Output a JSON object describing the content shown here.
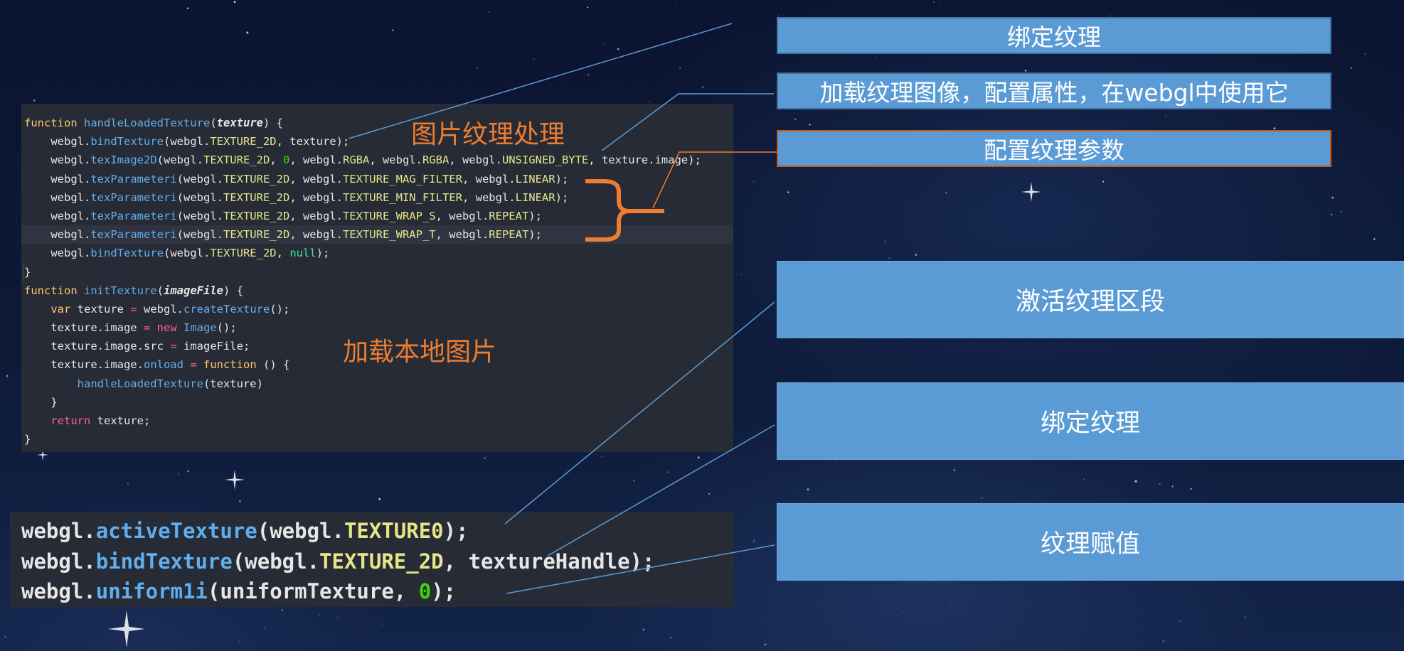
{
  "annotations": {
    "texture_processing": "图片纹理处理",
    "load_local_image": "加载本地图片"
  },
  "labels": {
    "bind_texture_top": "绑定纹理",
    "load_image": "加载纹理图像，配置属性，在webgl中使用它",
    "configure_params": "配置纹理参数",
    "activate_unit": "激活纹理区段",
    "bind_texture": "绑定纹理",
    "assign_texture": "纹理赋值"
  },
  "colors": {
    "label_bg": "#5b9bd5",
    "annotation": "#ed7d31",
    "connector": "#5b9bd5",
    "code_bg": "#272b35"
  },
  "code_main": [
    [
      [
        "kw",
        "function"
      ],
      [
        "plain",
        " "
      ],
      [
        "fn",
        "handleLoadedTexture"
      ],
      [
        "plain",
        "("
      ],
      [
        "param",
        "texture"
      ],
      [
        "plain",
        ") {"
      ]
    ],
    [
      [
        "plain",
        "    webgl."
      ],
      [
        "fn",
        "bindTexture"
      ],
      [
        "plain",
        "(webgl."
      ],
      [
        "const",
        "TEXTURE_2D"
      ],
      [
        "plain",
        ", texture);"
      ]
    ],
    [
      [
        "plain",
        "    webgl."
      ],
      [
        "fn",
        "texImage2D"
      ],
      [
        "plain",
        "(webgl."
      ],
      [
        "const",
        "TEXTURE_2D"
      ],
      [
        "plain",
        ", "
      ],
      [
        "num",
        "0"
      ],
      [
        "plain",
        ", webgl."
      ],
      [
        "const",
        "RGBA"
      ],
      [
        "plain",
        ", webgl."
      ],
      [
        "const",
        "RGBA"
      ],
      [
        "plain",
        ", webgl."
      ],
      [
        "const",
        "UNSIGNED_BYTE"
      ],
      [
        "plain",
        ", texture.image);"
      ]
    ],
    [
      [
        "plain",
        "    webgl."
      ],
      [
        "fn",
        "texParameteri"
      ],
      [
        "plain",
        "(webgl."
      ],
      [
        "const",
        "TEXTURE_2D"
      ],
      [
        "plain",
        ", webgl."
      ],
      [
        "const",
        "TEXTURE_MAG_FILTER"
      ],
      [
        "plain",
        ", webgl."
      ],
      [
        "const",
        "LINEAR"
      ],
      [
        "plain",
        ");"
      ]
    ],
    [
      [
        "plain",
        "    webgl."
      ],
      [
        "fn",
        "texParameteri"
      ],
      [
        "plain",
        "(webgl."
      ],
      [
        "const",
        "TEXTURE_2D"
      ],
      [
        "plain",
        ", webgl."
      ],
      [
        "const",
        "TEXTURE_MIN_FILTER"
      ],
      [
        "plain",
        ", webgl."
      ],
      [
        "const",
        "LINEAR"
      ],
      [
        "plain",
        ");"
      ]
    ],
    [
      [
        "plain",
        "    webgl."
      ],
      [
        "fn",
        "texParameteri"
      ],
      [
        "plain",
        "(webgl."
      ],
      [
        "const",
        "TEXTURE_2D"
      ],
      [
        "plain",
        ", webgl."
      ],
      [
        "const",
        "TEXTURE_WRAP_S"
      ],
      [
        "plain",
        ", webgl."
      ],
      [
        "const",
        "REPEAT"
      ],
      [
        "plain",
        ");"
      ]
    ],
    [
      [
        "plain",
        "    webgl."
      ],
      [
        "fn",
        "texParameteri"
      ],
      [
        "plain",
        "(webgl."
      ],
      [
        "const",
        "TEXTURE_2D"
      ],
      [
        "plain",
        ", webgl."
      ],
      [
        "const",
        "TEXTURE_WRAP_T"
      ],
      [
        "plain",
        ", webgl."
      ],
      [
        "const",
        "REPEAT"
      ],
      [
        "plain",
        ");"
      ]
    ],
    [
      [
        "plain",
        "    webgl."
      ],
      [
        "fn",
        "bindTexture"
      ],
      [
        "plain",
        "(webgl."
      ],
      [
        "const",
        "TEXTURE_2D"
      ],
      [
        "plain",
        ", "
      ],
      [
        "null",
        "null"
      ],
      [
        "plain",
        ");"
      ]
    ],
    [
      [
        "plain",
        "}"
      ]
    ],
    [
      [
        "kw",
        "function"
      ],
      [
        "plain",
        " "
      ],
      [
        "fn",
        "initTexture"
      ],
      [
        "plain",
        "("
      ],
      [
        "param",
        "imageFile"
      ],
      [
        "plain",
        ") {"
      ]
    ],
    [
      [
        "plain",
        "    "
      ],
      [
        "kw",
        "var"
      ],
      [
        "plain",
        " texture "
      ],
      [
        "red",
        "="
      ],
      [
        "plain",
        " webgl."
      ],
      [
        "fn",
        "createTexture"
      ],
      [
        "plain",
        "();"
      ]
    ],
    [
      [
        "plain",
        "    texture.image "
      ],
      [
        "red",
        "="
      ],
      [
        "plain",
        " "
      ],
      [
        "red",
        "new"
      ],
      [
        "plain",
        " "
      ],
      [
        "type",
        "Image"
      ],
      [
        "plain",
        "();"
      ]
    ],
    [
      [
        "plain",
        "    texture.image.src "
      ],
      [
        "red",
        "="
      ],
      [
        "plain",
        " imageFile;"
      ]
    ],
    [
      [
        "plain",
        "    texture.image."
      ],
      [
        "fn",
        "onload"
      ],
      [
        "plain",
        " "
      ],
      [
        "red",
        "="
      ],
      [
        "plain",
        " "
      ],
      [
        "kw",
        "function"
      ],
      [
        "plain",
        " () {"
      ]
    ],
    [
      [
        "plain",
        "        "
      ],
      [
        "fn",
        "handleLoadedTexture"
      ],
      [
        "plain",
        "(texture)"
      ]
    ],
    [
      [
        "plain",
        "    }"
      ]
    ],
    [
      [
        "plain",
        "    "
      ],
      [
        "red",
        "return"
      ],
      [
        "plain",
        " texture;"
      ]
    ],
    [
      [
        "plain",
        "}"
      ]
    ]
  ],
  "code_bottom": [
    [
      [
        "plain",
        "webgl."
      ],
      [
        "fn",
        "activeTexture"
      ],
      [
        "plain",
        "(webgl."
      ],
      [
        "const",
        "TEXTURE0"
      ],
      [
        "plain",
        ");"
      ]
    ],
    [
      [
        "plain",
        "webgl."
      ],
      [
        "fn",
        "bindTexture"
      ],
      [
        "plain",
        "(webgl."
      ],
      [
        "const",
        "TEXTURE_2D"
      ],
      [
        "plain",
        ", textureHandle);"
      ]
    ],
    [
      [
        "plain",
        "webgl."
      ],
      [
        "fn",
        "uniform1i"
      ],
      [
        "plain",
        "(uniformTexture, "
      ],
      [
        "num",
        "0"
      ],
      [
        "plain",
        ");"
      ]
    ]
  ]
}
